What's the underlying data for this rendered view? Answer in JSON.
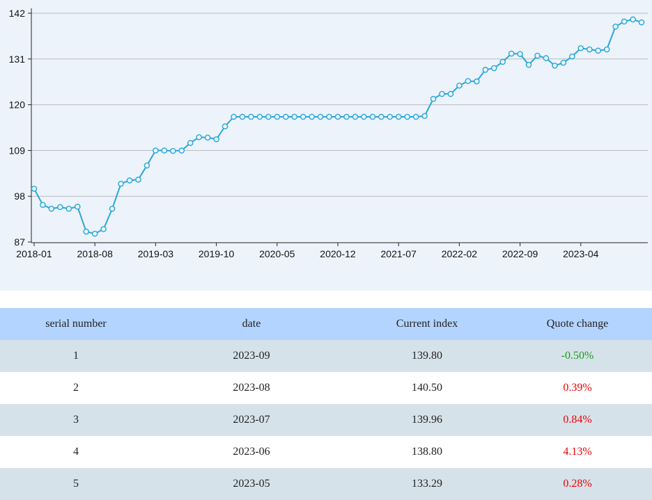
{
  "colors": {
    "line": "#2ba6d8",
    "marker_fill": "#e8f6fb",
    "grid": "#b9bcc0",
    "panel_bg": "#edf3fb",
    "header_bg": "#b3d4ff",
    "stripe_bg": "#d6e2ea",
    "negative": "#1a9a1a",
    "positive": "#ee0000"
  },
  "chart_data": {
    "type": "line",
    "title": "",
    "xlabel": "",
    "ylabel": "",
    "ylim": [
      87,
      142
    ],
    "yticks": [
      87,
      98,
      109,
      120,
      131,
      142
    ],
    "xtick_labels": [
      "2018-01",
      "2018-08",
      "2019-03",
      "2019-10",
      "2020-05",
      "2020-12",
      "2021-07",
      "2022-02",
      "2022-09",
      "2023-04"
    ],
    "grid": true,
    "legend": "none",
    "series": [
      {
        "name": "",
        "x_start": "2018-01",
        "x_end": "2023-09",
        "values": [
          99.8,
          95.9,
          95.0,
          95.4,
          95.0,
          95.5,
          89.5,
          89.0,
          90.1,
          95.0,
          101.0,
          101.8,
          102.0,
          105.4,
          109.0,
          109.0,
          108.9,
          109.0,
          110.8,
          112.2,
          112.1,
          111.7,
          114.8,
          117.1,
          117.1,
          117.1,
          117.1,
          117.1,
          117.1,
          117.1,
          117.1,
          117.1,
          117.1,
          117.1,
          117.1,
          117.1,
          117.1,
          117.1,
          117.1,
          117.1,
          117.1,
          117.1,
          117.1,
          117.1,
          117.1,
          117.3,
          121.4,
          122.6,
          122.6,
          124.6,
          125.7,
          125.6,
          128.4,
          128.8,
          130.3,
          132.3,
          132.2,
          129.6,
          131.8,
          131.2,
          129.4,
          130.1,
          131.6,
          133.6,
          133.3,
          133.0,
          133.3,
          138.8,
          140.0,
          140.5,
          139.8
        ]
      }
    ]
  },
  "table": {
    "headers": [
      "serial number",
      "date",
      "Current index",
      "Quote change"
    ],
    "rows": [
      {
        "serial": "1",
        "date": "2023-09",
        "index": "139.80",
        "change": "-0.50%"
      },
      {
        "serial": "2",
        "date": "2023-08",
        "index": "140.50",
        "change": "0.39%"
      },
      {
        "serial": "3",
        "date": "2023-07",
        "index": "139.96",
        "change": "0.84%"
      },
      {
        "serial": "4",
        "date": "2023-06",
        "index": "138.80",
        "change": "4.13%"
      },
      {
        "serial": "5",
        "date": "2023-05",
        "index": "133.29",
        "change": "0.28%"
      }
    ]
  }
}
